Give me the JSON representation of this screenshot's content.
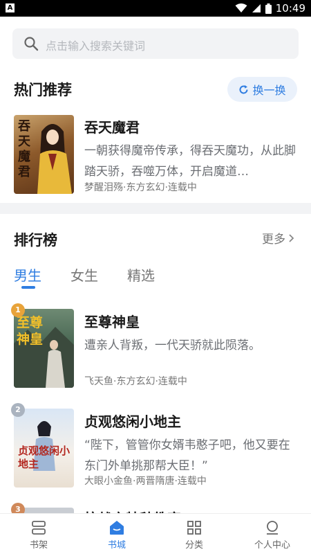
{
  "statusbar": {
    "app_badge": "A",
    "time": "10:49"
  },
  "search": {
    "placeholder": "点击输入搜索关键词"
  },
  "hot": {
    "title": "热门推荐",
    "refresh_label": "换一换",
    "book": {
      "title": "吞天魔君",
      "cover_text": "吞天魔君",
      "desc": "一朝获得魔帝传承，得吞天魔功，从此脚踏天骄，吞噬万体，开启魔道…",
      "meta": "梦醒泪殇·东方玄幻·连载中"
    }
  },
  "ranking": {
    "title": "排行榜",
    "more_label": "更多",
    "tabs": [
      {
        "label": "男生",
        "active": true
      },
      {
        "label": "女生",
        "active": false
      },
      {
        "label": "精选",
        "active": false
      }
    ],
    "books": [
      {
        "rank": "1",
        "title": "至尊神皇",
        "cover_text": "至尊神皇",
        "desc": "遭亲人背叛，一代天骄就此陨落。",
        "meta": "飞天鱼·东方玄幻·连载中"
      },
      {
        "rank": "2",
        "title": "贞观悠闲小地主",
        "cover_text": "贞观悠闲小地主",
        "desc": "“陛下，管管你女婿韦憨子吧，他又要在东门外单挑那帮大臣！”",
        "meta": "大眼小金鱼·两晋隋唐·连载中"
      },
      {
        "rank": "3",
        "title": "抗战之特种教官",
        "cover_text": ""
      }
    ]
  },
  "bottom_nav": [
    {
      "label": "书架",
      "icon": "bookshelf-icon",
      "active": false
    },
    {
      "label": "书城",
      "icon": "bookstore-icon",
      "active": true
    },
    {
      "label": "分类",
      "icon": "category-grid-icon",
      "active": false
    },
    {
      "label": "个人中心",
      "icon": "user-icon",
      "active": false
    }
  ],
  "colors": {
    "accent": "#2f7de1",
    "gold": "#e8a33a",
    "silver": "#aab3bf",
    "bronze": "#d0895a"
  }
}
